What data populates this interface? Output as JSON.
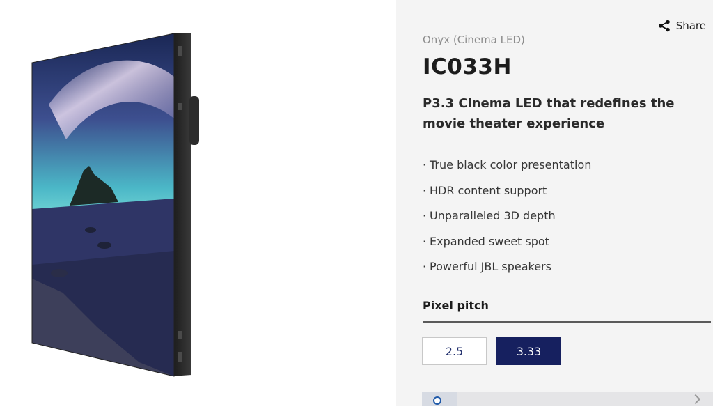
{
  "share": {
    "label": "Share",
    "icon": "share-icon"
  },
  "product": {
    "category": "Onyx (Cinema LED)",
    "model": "IC033H",
    "tagline": "P3.3 Cinema LED that redefines the movie theater experience",
    "features": [
      "True black color presentation",
      "HDR content support",
      "Unparalleled 3D depth",
      "Expanded sweet spot",
      "Powerful JBL speakers"
    ]
  },
  "pixel_pitch": {
    "label": "Pixel pitch",
    "options": [
      "2.5",
      "3.33"
    ],
    "selected": "3.33"
  },
  "colors": {
    "accent": "#16205f",
    "panel_bg": "#f4f4f4"
  }
}
